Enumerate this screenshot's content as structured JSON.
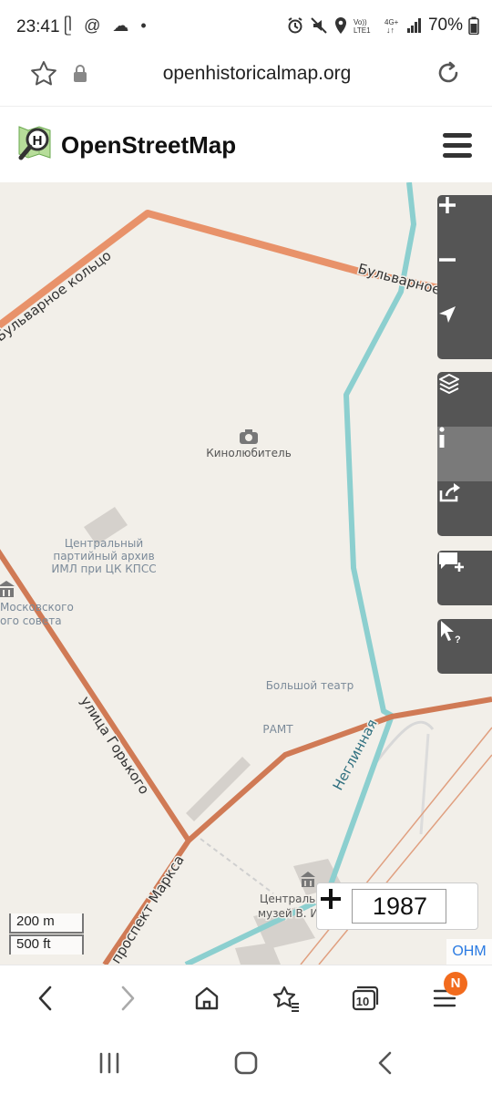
{
  "status": {
    "time": "23:41",
    "left_icons": "ᥫ @ ☁ •",
    "battery": "70%"
  },
  "browser": {
    "url": "openhistoricalmap.org"
  },
  "osm": {
    "title": "OpenStreetMap"
  },
  "map": {
    "street_labels": {
      "boulevard_ring_left": "Бульварное кольцо",
      "boulevard_ring_right": "Бульварное кольцо",
      "gorkogo": "улица Горького",
      "marksa": "проспект Маркса",
      "neglinnaya": "Неглинная"
    },
    "poi_labels": {
      "kinolyubitel": "Кинолюбитель",
      "archive_line1": "Центральный",
      "archive_line2": "партийный архив",
      "archive_line3": "ИМЛ при ЦК КПСС",
      "mossovet_line1": "Московского",
      "mossovet_line2": "ого совета",
      "bolshoi": "Большой театр",
      "ramt": "РАМТ",
      "museum_line1": "Центральн",
      "museum_line2": "музей В. И."
    },
    "scale": {
      "metric": "200 m",
      "imperial": "500 ft"
    },
    "year": "1987",
    "attribution": "OHM",
    "colors": {
      "land": "#f2efe9",
      "ring_road": "#e8926a",
      "main_street": "#d07a55",
      "river": "#8ccfcf",
      "building": "#d5d1cc",
      "controls": "#555555"
    }
  },
  "controls": {
    "zoom_in": "zoom-in",
    "zoom_out": "zoom-out",
    "locate": "locate",
    "layers": "layers",
    "info": "info",
    "share": "share",
    "note": "add-note",
    "query": "query-features"
  },
  "toolbar": {
    "tab_count": "10",
    "notification": "N"
  }
}
